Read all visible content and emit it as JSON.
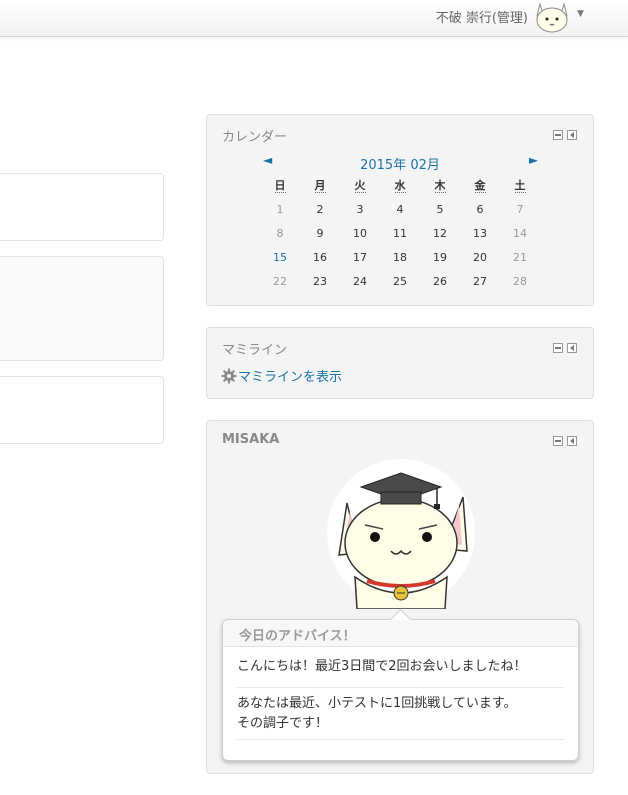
{
  "navbar": {
    "user_name": "不破 崇行(管理)",
    "caret": "▼"
  },
  "calendar": {
    "title": "カレンダー",
    "prev": "◄",
    "next": "►",
    "month": "2015年 02月",
    "weekdays": [
      "日",
      "月",
      "火",
      "水",
      "木",
      "金",
      "土"
    ],
    "weeks": [
      [
        "1",
        "2",
        "3",
        "4",
        "5",
        "6",
        "7"
      ],
      [
        "8",
        "9",
        "10",
        "11",
        "12",
        "13",
        "14"
      ],
      [
        "15",
        "16",
        "17",
        "18",
        "19",
        "20",
        "21"
      ],
      [
        "22",
        "23",
        "24",
        "25",
        "26",
        "27",
        "28"
      ]
    ],
    "today": "15"
  },
  "mamiline": {
    "title": "マミライン",
    "link": "マミラインを表示"
  },
  "misaka": {
    "title": "MISAKA",
    "advice_title": "今日のアドバイス！",
    "advice_1": "こんにちは！最近3日間で2回お会いしましたね！",
    "advice_2_line1": "あなたは最近、小テストに1回挑戦しています。",
    "advice_2_line2": "その調子です！"
  },
  "colors": {
    "link": "#1a72a8",
    "block_bg": "#f4f4f4",
    "bell": "#e8c33a",
    "collar": "#d33a2c"
  }
}
